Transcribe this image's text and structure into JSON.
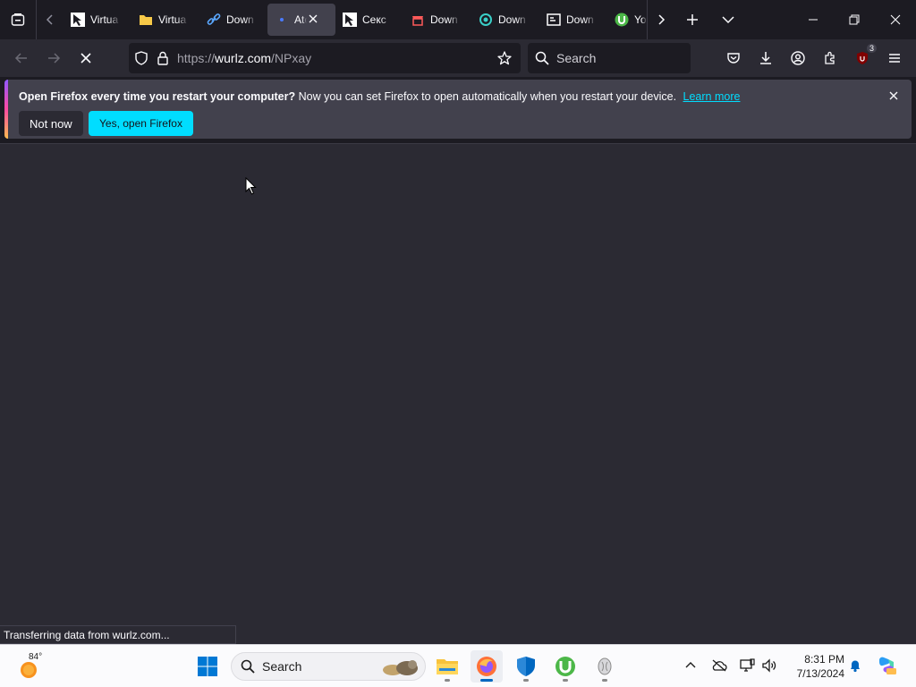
{
  "browser": {
    "tabs": [
      {
        "title": "Virtua",
        "icon": "cursor-favicon-icon",
        "color": "#ffffff"
      },
      {
        "title": "Virtua",
        "icon": "folder-favicon-icon",
        "color": "#f7c948"
      },
      {
        "title": "Down",
        "icon": "link-favicon-icon",
        "color": "#5aa7ff"
      },
      {
        "title": "Atc",
        "icon": "loading-dot-icon",
        "color": "#4a7bff",
        "active": true
      },
      {
        "title": "Cекс",
        "icon": "cursor-favicon-icon",
        "color": "#ffffff"
      },
      {
        "title": "Down",
        "icon": "store-favicon-icon",
        "color": "#ff5a5a"
      },
      {
        "title": "Down",
        "icon": "swirl-favicon-icon",
        "color": "#3ad0c8"
      },
      {
        "title": "Down",
        "icon": "badge-favicon-icon",
        "color": "#ffffff"
      },
      {
        "title": "You",
        "icon": "utorrent-favicon-icon",
        "color": "#4cb748"
      }
    ],
    "url": {
      "protocol": "https://",
      "host": "wurlz.com",
      "path": "/NPxay"
    },
    "search_placeholder": "Search",
    "extension_badge": "3"
  },
  "notification": {
    "title": "Open Firefox every time you restart your computer?",
    "message": "Now you can set Firefox to open automatically when you restart your device.",
    "link": "Learn more",
    "secondary_button": "Not now",
    "primary_button": "Yes, open Firefox"
  },
  "status": "Transferring data from wurlz.com...",
  "taskbar": {
    "weather_temp": "84°",
    "search_label": "Search",
    "time": "8:31 PM",
    "date": "7/13/2024"
  },
  "colors": {
    "accent": "#00ddff",
    "toolbar": "#2b2a33",
    "tabstrip": "#1c1b22"
  }
}
